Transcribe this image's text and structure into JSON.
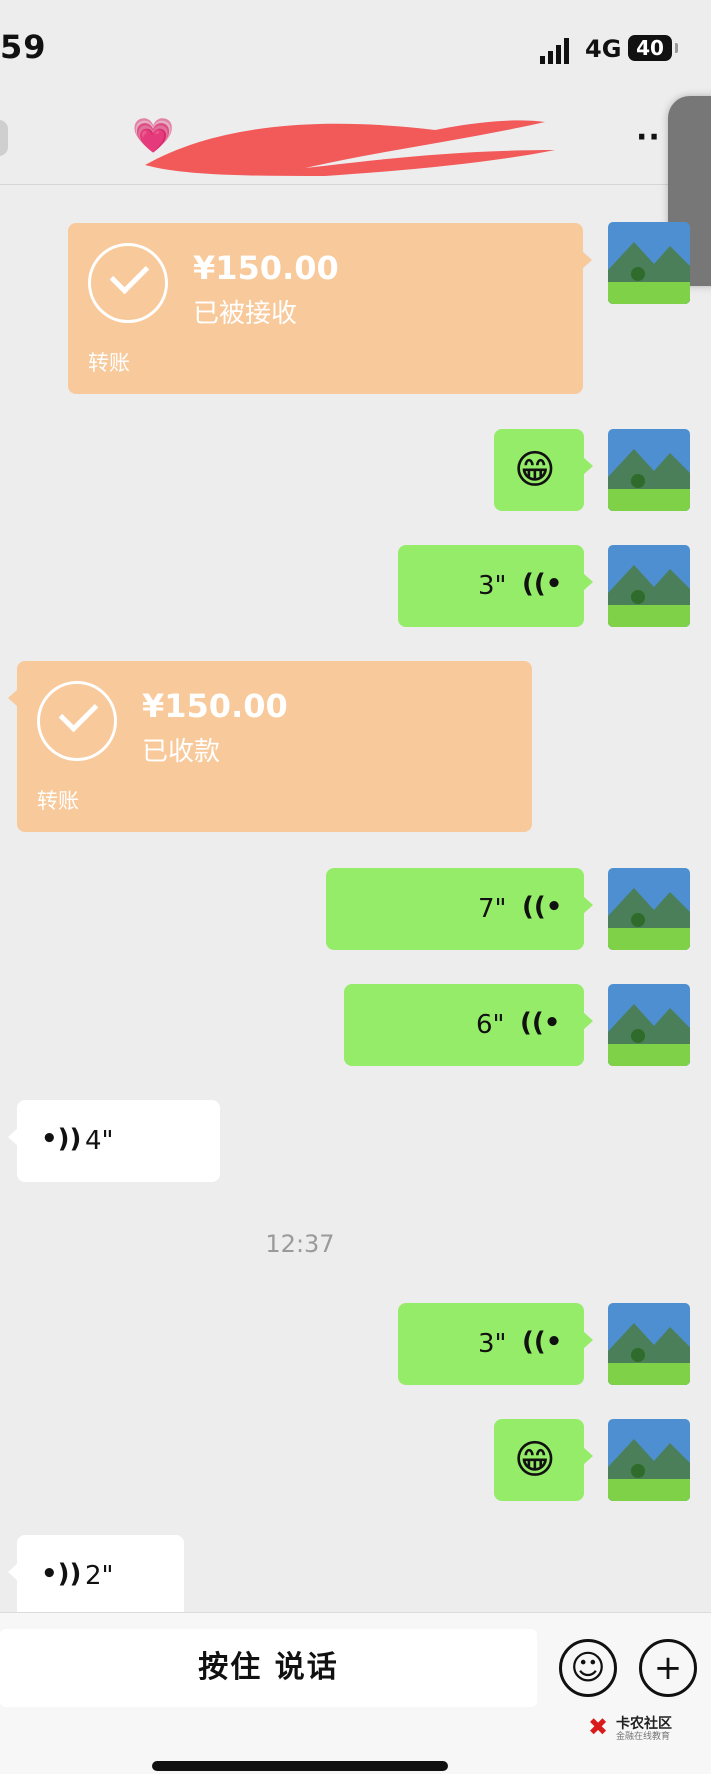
{
  "status_bar": {
    "time": "59",
    "network": "4G",
    "battery": "40"
  },
  "nav": {
    "title_emoji": "💗",
    "more_label": "··"
  },
  "side_tab": {
    "icon": "chevron-left-icon",
    "glyph": "〈"
  },
  "messages": [
    {
      "type": "transfer",
      "side": "right",
      "amount": "¥150.00",
      "status": "已被接收",
      "label": "转账"
    },
    {
      "type": "emoji",
      "side": "right",
      "text": "😁"
    },
    {
      "type": "voice",
      "side": "right",
      "duration": "3\""
    },
    {
      "type": "transfer",
      "side": "left",
      "amount": "¥150.00",
      "status": "已收款",
      "label": "转账"
    },
    {
      "type": "voice",
      "side": "right",
      "duration": "7\""
    },
    {
      "type": "voice",
      "side": "right",
      "duration": "6\""
    },
    {
      "type": "voice",
      "side": "left",
      "duration": "4\""
    },
    {
      "type": "timestamp",
      "text": "12:37"
    },
    {
      "type": "voice",
      "side": "right",
      "duration": "3\""
    },
    {
      "type": "emoji",
      "side": "right",
      "text": "😁"
    },
    {
      "type": "voice",
      "side": "left",
      "duration": "2\""
    }
  ],
  "input_bar": {
    "voice_button_label": "按住 说话",
    "emoji_icon": "smiley-icon",
    "plus_icon": "plus-icon"
  },
  "watermark": {
    "title": "卡农社区",
    "subtitle": "金融在线教育"
  },
  "colors": {
    "background": "#ededed",
    "green_bubble": "#95ec69",
    "transfer_bubble": "#f8c99a",
    "redaction": "#f25a5a"
  }
}
